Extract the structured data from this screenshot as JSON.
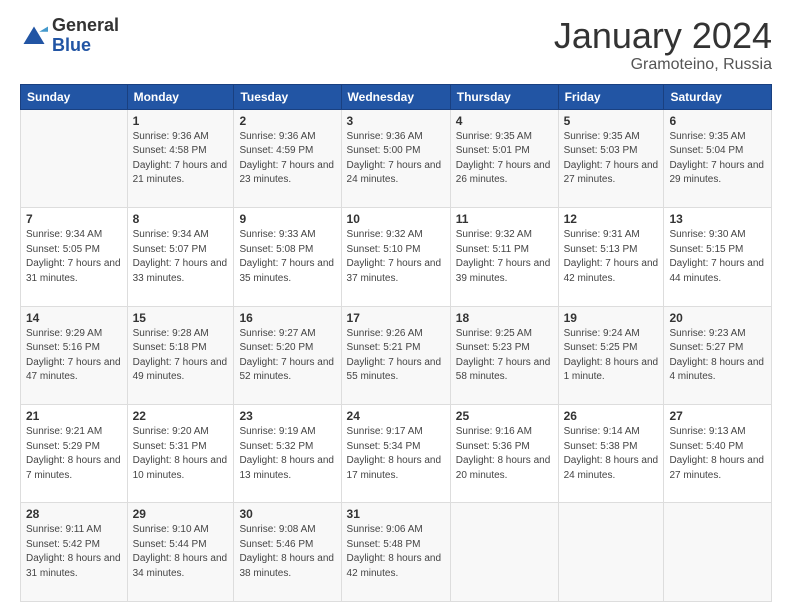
{
  "logo": {
    "general": "General",
    "blue": "Blue"
  },
  "title": {
    "month": "January 2024",
    "location": "Gramoteino, Russia"
  },
  "weekdays": [
    "Sunday",
    "Monday",
    "Tuesday",
    "Wednesday",
    "Thursday",
    "Friday",
    "Saturday"
  ],
  "weeks": [
    [
      {
        "day": "",
        "sunrise": "",
        "sunset": "",
        "daylight": ""
      },
      {
        "day": "1",
        "sunrise": "Sunrise: 9:36 AM",
        "sunset": "Sunset: 4:58 PM",
        "daylight": "Daylight: 7 hours and 21 minutes."
      },
      {
        "day": "2",
        "sunrise": "Sunrise: 9:36 AM",
        "sunset": "Sunset: 4:59 PM",
        "daylight": "Daylight: 7 hours and 23 minutes."
      },
      {
        "day": "3",
        "sunrise": "Sunrise: 9:36 AM",
        "sunset": "Sunset: 5:00 PM",
        "daylight": "Daylight: 7 hours and 24 minutes."
      },
      {
        "day": "4",
        "sunrise": "Sunrise: 9:35 AM",
        "sunset": "Sunset: 5:01 PM",
        "daylight": "Daylight: 7 hours and 26 minutes."
      },
      {
        "day": "5",
        "sunrise": "Sunrise: 9:35 AM",
        "sunset": "Sunset: 5:03 PM",
        "daylight": "Daylight: 7 hours and 27 minutes."
      },
      {
        "day": "6",
        "sunrise": "Sunrise: 9:35 AM",
        "sunset": "Sunset: 5:04 PM",
        "daylight": "Daylight: 7 hours and 29 minutes."
      }
    ],
    [
      {
        "day": "7",
        "sunrise": "Sunrise: 9:34 AM",
        "sunset": "Sunset: 5:05 PM",
        "daylight": "Daylight: 7 hours and 31 minutes."
      },
      {
        "day": "8",
        "sunrise": "Sunrise: 9:34 AM",
        "sunset": "Sunset: 5:07 PM",
        "daylight": "Daylight: 7 hours and 33 minutes."
      },
      {
        "day": "9",
        "sunrise": "Sunrise: 9:33 AM",
        "sunset": "Sunset: 5:08 PM",
        "daylight": "Daylight: 7 hours and 35 minutes."
      },
      {
        "day": "10",
        "sunrise": "Sunrise: 9:32 AM",
        "sunset": "Sunset: 5:10 PM",
        "daylight": "Daylight: 7 hours and 37 minutes."
      },
      {
        "day": "11",
        "sunrise": "Sunrise: 9:32 AM",
        "sunset": "Sunset: 5:11 PM",
        "daylight": "Daylight: 7 hours and 39 minutes."
      },
      {
        "day": "12",
        "sunrise": "Sunrise: 9:31 AM",
        "sunset": "Sunset: 5:13 PM",
        "daylight": "Daylight: 7 hours and 42 minutes."
      },
      {
        "day": "13",
        "sunrise": "Sunrise: 9:30 AM",
        "sunset": "Sunset: 5:15 PM",
        "daylight": "Daylight: 7 hours and 44 minutes."
      }
    ],
    [
      {
        "day": "14",
        "sunrise": "Sunrise: 9:29 AM",
        "sunset": "Sunset: 5:16 PM",
        "daylight": "Daylight: 7 hours and 47 minutes."
      },
      {
        "day": "15",
        "sunrise": "Sunrise: 9:28 AM",
        "sunset": "Sunset: 5:18 PM",
        "daylight": "Daylight: 7 hours and 49 minutes."
      },
      {
        "day": "16",
        "sunrise": "Sunrise: 9:27 AM",
        "sunset": "Sunset: 5:20 PM",
        "daylight": "Daylight: 7 hours and 52 minutes."
      },
      {
        "day": "17",
        "sunrise": "Sunrise: 9:26 AM",
        "sunset": "Sunset: 5:21 PM",
        "daylight": "Daylight: 7 hours and 55 minutes."
      },
      {
        "day": "18",
        "sunrise": "Sunrise: 9:25 AM",
        "sunset": "Sunset: 5:23 PM",
        "daylight": "Daylight: 7 hours and 58 minutes."
      },
      {
        "day": "19",
        "sunrise": "Sunrise: 9:24 AM",
        "sunset": "Sunset: 5:25 PM",
        "daylight": "Daylight: 8 hours and 1 minute."
      },
      {
        "day": "20",
        "sunrise": "Sunrise: 9:23 AM",
        "sunset": "Sunset: 5:27 PM",
        "daylight": "Daylight: 8 hours and 4 minutes."
      }
    ],
    [
      {
        "day": "21",
        "sunrise": "Sunrise: 9:21 AM",
        "sunset": "Sunset: 5:29 PM",
        "daylight": "Daylight: 8 hours and 7 minutes."
      },
      {
        "day": "22",
        "sunrise": "Sunrise: 9:20 AM",
        "sunset": "Sunset: 5:31 PM",
        "daylight": "Daylight: 8 hours and 10 minutes."
      },
      {
        "day": "23",
        "sunrise": "Sunrise: 9:19 AM",
        "sunset": "Sunset: 5:32 PM",
        "daylight": "Daylight: 8 hours and 13 minutes."
      },
      {
        "day": "24",
        "sunrise": "Sunrise: 9:17 AM",
        "sunset": "Sunset: 5:34 PM",
        "daylight": "Daylight: 8 hours and 17 minutes."
      },
      {
        "day": "25",
        "sunrise": "Sunrise: 9:16 AM",
        "sunset": "Sunset: 5:36 PM",
        "daylight": "Daylight: 8 hours and 20 minutes."
      },
      {
        "day": "26",
        "sunrise": "Sunrise: 9:14 AM",
        "sunset": "Sunset: 5:38 PM",
        "daylight": "Daylight: 8 hours and 24 minutes."
      },
      {
        "day": "27",
        "sunrise": "Sunrise: 9:13 AM",
        "sunset": "Sunset: 5:40 PM",
        "daylight": "Daylight: 8 hours and 27 minutes."
      }
    ],
    [
      {
        "day": "28",
        "sunrise": "Sunrise: 9:11 AM",
        "sunset": "Sunset: 5:42 PM",
        "daylight": "Daylight: 8 hours and 31 minutes."
      },
      {
        "day": "29",
        "sunrise": "Sunrise: 9:10 AM",
        "sunset": "Sunset: 5:44 PM",
        "daylight": "Daylight: 8 hours and 34 minutes."
      },
      {
        "day": "30",
        "sunrise": "Sunrise: 9:08 AM",
        "sunset": "Sunset: 5:46 PM",
        "daylight": "Daylight: 8 hours and 38 minutes."
      },
      {
        "day": "31",
        "sunrise": "Sunrise: 9:06 AM",
        "sunset": "Sunset: 5:48 PM",
        "daylight": "Daylight: 8 hours and 42 minutes."
      },
      {
        "day": "",
        "sunrise": "",
        "sunset": "",
        "daylight": ""
      },
      {
        "day": "",
        "sunrise": "",
        "sunset": "",
        "daylight": ""
      },
      {
        "day": "",
        "sunrise": "",
        "sunset": "",
        "daylight": ""
      }
    ]
  ]
}
